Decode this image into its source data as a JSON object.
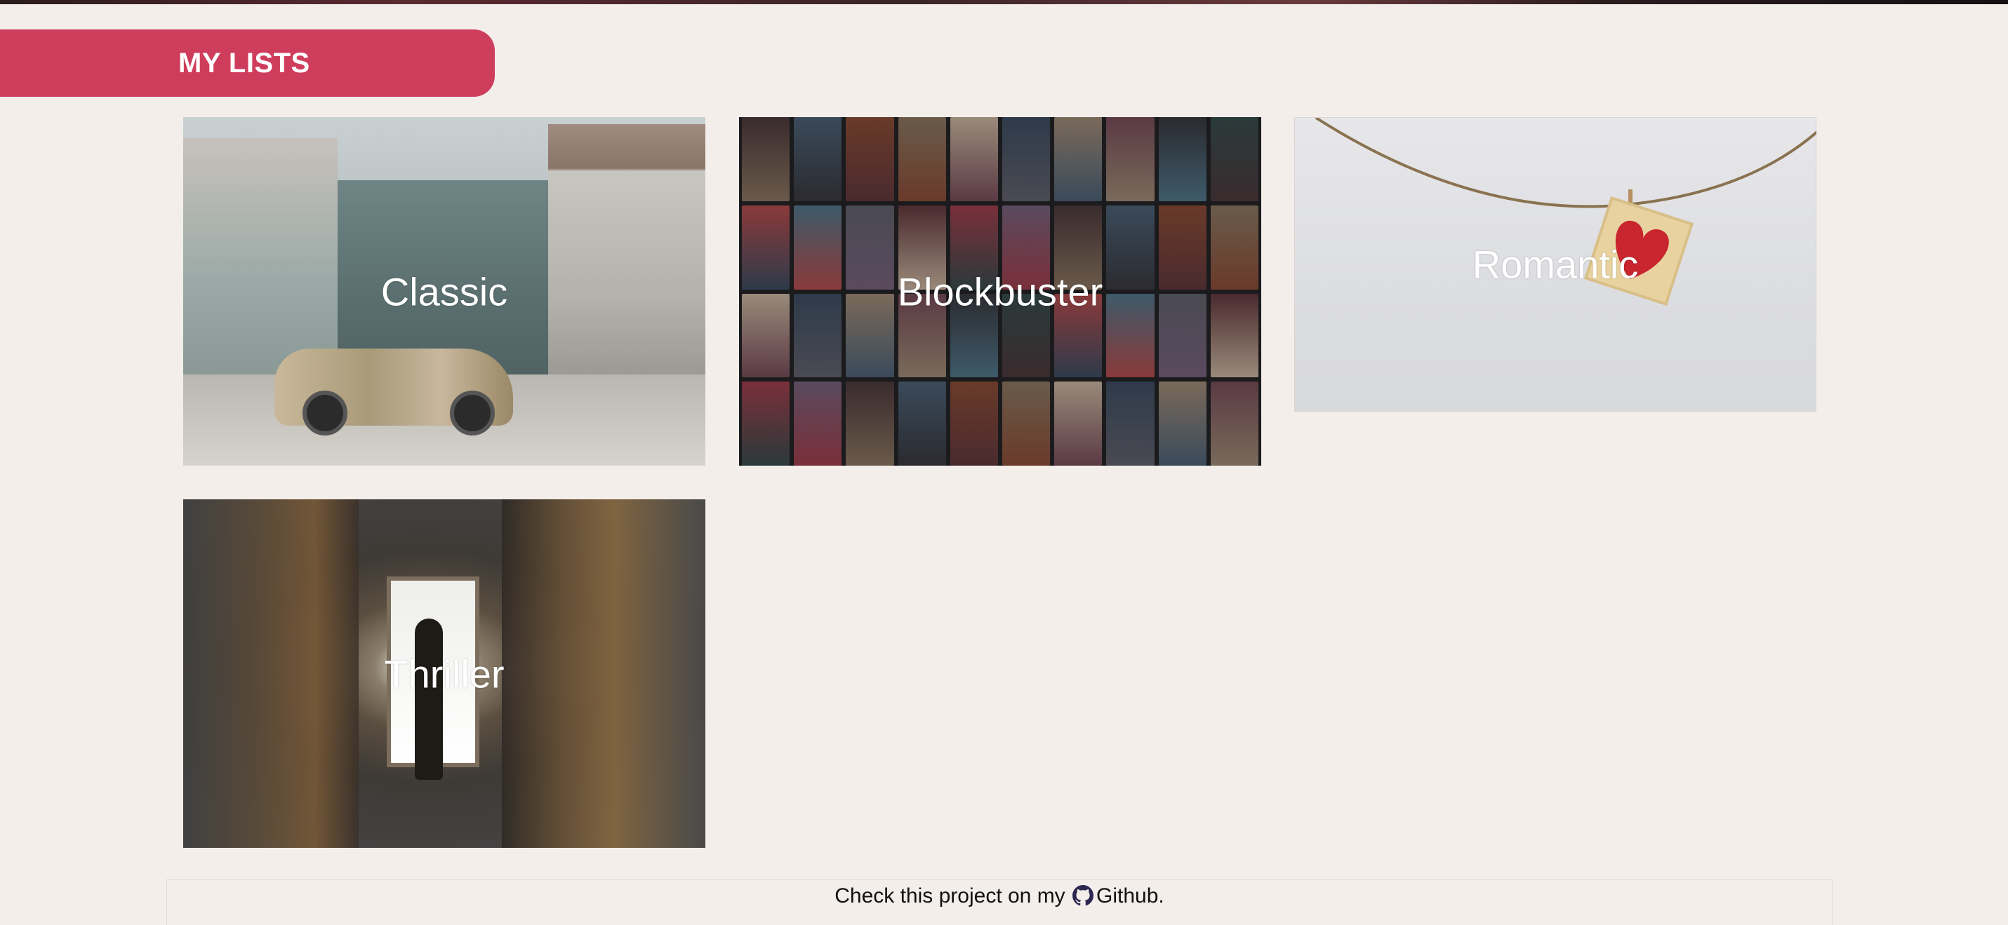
{
  "header": {
    "title": "MY LISTS",
    "accent_color": "#cf3d5c"
  },
  "lists": [
    {
      "label": "Classic",
      "image": "street-with-vintage-car-photo"
    },
    {
      "label": "Blockbuster",
      "image": "vhs-tapes-wall-photo"
    },
    {
      "label": "Romantic",
      "image": "heart-on-string-photo"
    },
    {
      "label": "Thriller",
      "image": "dark-corridor-figure-photo"
    }
  ],
  "footer": {
    "prefix": "Check this project on my",
    "link_label": "Github",
    "suffix": ".",
    "icon": "github-icon"
  }
}
